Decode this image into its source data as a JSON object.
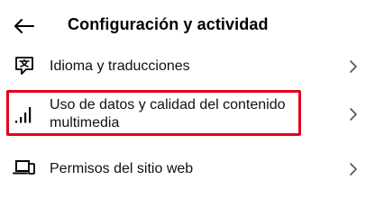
{
  "header": {
    "back_icon": "arrow-left-icon",
    "title": "Configuración y actividad"
  },
  "settings": {
    "items": [
      {
        "label": "Idioma y traducciones",
        "icon": "translate-icon",
        "chevron": "chevron-right-icon"
      },
      {
        "label": "Uso de datos y calidad del contenido multimedia",
        "icon": "signal-bars-icon",
        "chevron": "chevron-right-icon",
        "highlighted": true,
        "highlight_color": "#e3001b"
      },
      {
        "label": "Permisos del sitio web",
        "icon": "devices-icon",
        "chevron": "chevron-right-icon"
      }
    ]
  }
}
